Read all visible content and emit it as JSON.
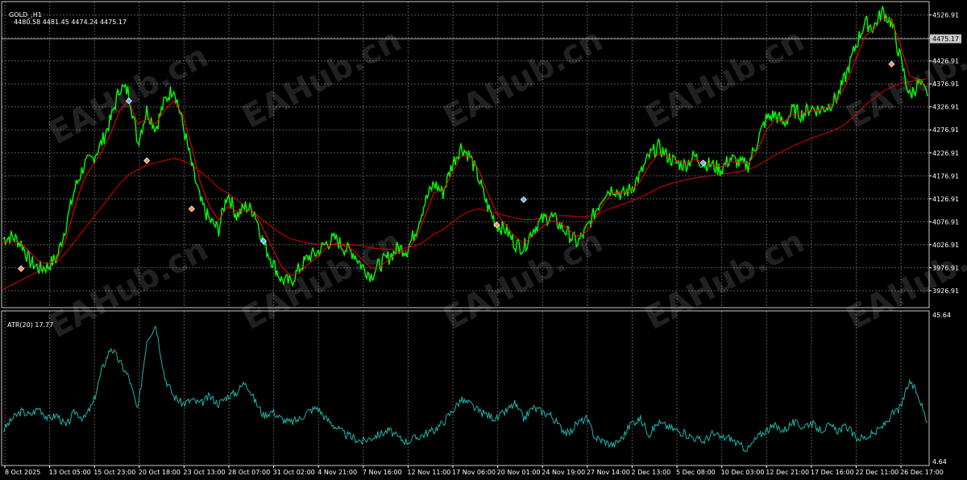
{
  "main_header": {
    "symbol": "GOLD_,H1",
    "ohlc": "4480.58 4481.45 4474.24 4475.17"
  },
  "atr_header": {
    "label": "ATR(20) 17.77"
  },
  "watermark_text": "EAHub.cn",
  "colors": {
    "background": "#000000",
    "grid": "#595959",
    "price": "#00ff00",
    "ma_fast": "#ff0000",
    "ma_slow": "#dd0000",
    "atr": "#20b2aa",
    "axis_text": "#ffffff",
    "current_price_line": "#9aa0a8"
  },
  "chart_data": [
    {
      "type": "line",
      "title": "GOLD_,H1",
      "current_price": 4475.17,
      "ylim": [
        3890,
        4556
      ],
      "y_ticks": [
        4526.91,
        4476.91,
        4426.91,
        4376.91,
        4326.91,
        4276.91,
        4226.91,
        4176.91,
        4126.91,
        4076.91,
        4026.91,
        3976.91,
        3926.91
      ],
      "y_tick_labels": [
        "4526.91",
        "4475.17",
        "4426.91",
        "4376.91",
        "4326.91",
        "4276.91",
        "4226.91",
        "4176.91",
        "4126.91",
        "4076.91",
        "4026.91",
        "3976.91",
        "3926.91"
      ],
      "x_tick_labels": [
        "8 Oct 2025",
        "13 Oct 05:00",
        "15 Oct 23:00",
        "20 Oct 18:00",
        "23 Oct 13:00",
        "28 Oct 07:00",
        "31 Oct 02:00",
        "4 Nov 21:00",
        "7 Nov 16:00",
        "12 Nov 11:00",
        "17 Nov 06:00",
        "20 Nov 01:00",
        "24 Nov 19:00",
        "27 Nov 14:00",
        "2 Dec 13:00",
        "5 Dec 08:00",
        "10 Dec 03:00",
        "12 Dec 21:00",
        "17 Dec 16:00",
        "22 Dec 11:00",
        "26 Dec 17:00"
      ],
      "series": [
        {
          "kind": "price",
          "values": [
            4040,
            4045,
            4030,
            3990,
            3975,
            3980,
            4000,
            4070,
            4150,
            4200,
            4215,
            4250,
            4300,
            4370,
            4360,
            4250,
            4320,
            4280,
            4340,
            4370,
            4290,
            4200,
            4120,
            4080,
            4060,
            4140,
            4090,
            4110,
            4100,
            4030,
            3990,
            3950,
            3945,
            3975,
            4000,
            4010,
            4030,
            4040,
            4020,
            4010,
            3980,
            3960,
            3985,
            4000,
            4020,
            4015,
            4060,
            4120,
            4160,
            4140,
            4200,
            4240,
            4220,
            4170,
            4110,
            4070,
            4060,
            4030,
            4020,
            4060,
            4080,
            4090,
            4070,
            4050,
            4030,
            4060,
            4100,
            4140,
            4150,
            4135,
            4150,
            4180,
            4220,
            4240,
            4220,
            4205,
            4200,
            4220,
            4205,
            4200,
            4190,
            4215,
            4205,
            4200,
            4250,
            4300,
            4310,
            4290,
            4320,
            4310,
            4325,
            4320,
            4330,
            4350,
            4400,
            4460,
            4510,
            4500,
            4535,
            4510,
            4430,
            4350,
            4380,
            4350
          ]
        },
        {
          "kind": "ma_fast",
          "values": [
            4030,
            4035,
            4030,
            4010,
            3990,
            3985,
            3995,
            4040,
            4110,
            4170,
            4200,
            4230,
            4270,
            4320,
            4340,
            4290,
            4300,
            4290,
            4320,
            4340,
            4310,
            4240,
            4160,
            4110,
            4080,
            4110,
            4100,
            4100,
            4100,
            4060,
            4020,
            3980,
            3960,
            3965,
            3985,
            4000,
            4020,
            4030,
            4025,
            4015,
            3995,
            3975,
            3980,
            3995,
            4010,
            4015,
            4040,
            4090,
            4140,
            4145,
            4180,
            4220,
            4220,
            4190,
            4140,
            4095,
            4070,
            4045,
            4030,
            4045,
            4065,
            4080,
            4075,
            4060,
            4045,
            4055,
            4085,
            4120,
            4140,
            4140,
            4145,
            4165,
            4200,
            4225,
            4220,
            4210,
            4205,
            4212,
            4208,
            4203,
            4196,
            4208,
            4206,
            4203,
            4230,
            4275,
            4300,
            4295,
            4310,
            4312,
            4320,
            4320,
            4328,
            4342,
            4380,
            4430,
            4480,
            4495,
            4520,
            4515,
            4460,
            4395,
            4385,
            4370
          ]
        },
        {
          "kind": "ma_slow",
          "values": [
            3930,
            3940,
            3950,
            3960,
            3970,
            3980,
            3990,
            4010,
            4035,
            4060,
            4085,
            4110,
            4135,
            4160,
            4180,
            4190,
            4200,
            4205,
            4210,
            4215,
            4210,
            4200,
            4185,
            4170,
            4150,
            4140,
            4125,
            4110,
            4095,
            4080,
            4065,
            4050,
            4040,
            4035,
            4030,
            4028,
            4027,
            4028,
            4028,
            4027,
            4025,
            4020,
            4018,
            4017,
            4018,
            4020,
            4025,
            4035,
            4050,
            4060,
            4075,
            4090,
            4100,
            4105,
            4100,
            4095,
            4090,
            4085,
            4082,
            4082,
            4085,
            4088,
            4090,
            4090,
            4088,
            4088,
            4092,
            4100,
            4108,
            4115,
            4122,
            4130,
            4140,
            4150,
            4158,
            4163,
            4168,
            4172,
            4175,
            4178,
            4180,
            4183,
            4186,
            4190,
            4198,
            4210,
            4222,
            4232,
            4242,
            4250,
            4258,
            4265,
            4272,
            4280,
            4292,
            4310,
            4330,
            4345,
            4360,
            4370,
            4378,
            4382,
            4386,
            4388
          ]
        }
      ],
      "markers": [
        {
          "index": 2,
          "value": 3975,
          "color": "#ff8c5a"
        },
        {
          "index": 14,
          "value": 4340,
          "color": "#5ab4ff"
        },
        {
          "index": 16,
          "value": 4210,
          "color": "#ff8c5a"
        },
        {
          "index": 21,
          "value": 4105,
          "color": "#ff8c5a"
        },
        {
          "index": 29,
          "value": 4035,
          "color": "#5ab4ff"
        },
        {
          "index": 55,
          "value": 4070,
          "color": "#ff8c5a"
        },
        {
          "index": 58,
          "value": 4125,
          "color": "#5ab4ff"
        },
        {
          "index": 78,
          "value": 4205,
          "color": "#5ab4ff"
        },
        {
          "index": 99,
          "value": 4420,
          "color": "#ff8c5a"
        }
      ]
    },
    {
      "type": "line",
      "title": "ATR(20) 17.77",
      "ylim": [
        4.64,
        45.64
      ],
      "y_tick_labels": [
        "45.64",
        "4.64"
      ],
      "series": [
        {
          "kind": "atr",
          "values": [
            14,
            17,
            19,
            18,
            20,
            17,
            18,
            15,
            19,
            17,
            21,
            30,
            36,
            32,
            28,
            19,
            38,
            42,
            28,
            23,
            21,
            22,
            21,
            23,
            21,
            23,
            24,
            27,
            22,
            18,
            19,
            17,
            16,
            17,
            19,
            20,
            17,
            15,
            13,
            12,
            11,
            12,
            13,
            14,
            12,
            11,
            12,
            13,
            14,
            16,
            19,
            22,
            21,
            19,
            18,
            17,
            19,
            21,
            17,
            20,
            19,
            18,
            15,
            13,
            16,
            17,
            12,
            11,
            10,
            12,
            16,
            17,
            13,
            16,
            15,
            14,
            13,
            12,
            11,
            13,
            12,
            12,
            10,
            9,
            12,
            14,
            15,
            14,
            16,
            15,
            16,
            14,
            15,
            14,
            15,
            12,
            12,
            13,
            15,
            18,
            20,
            27,
            23,
            16
          ]
        }
      ]
    }
  ]
}
